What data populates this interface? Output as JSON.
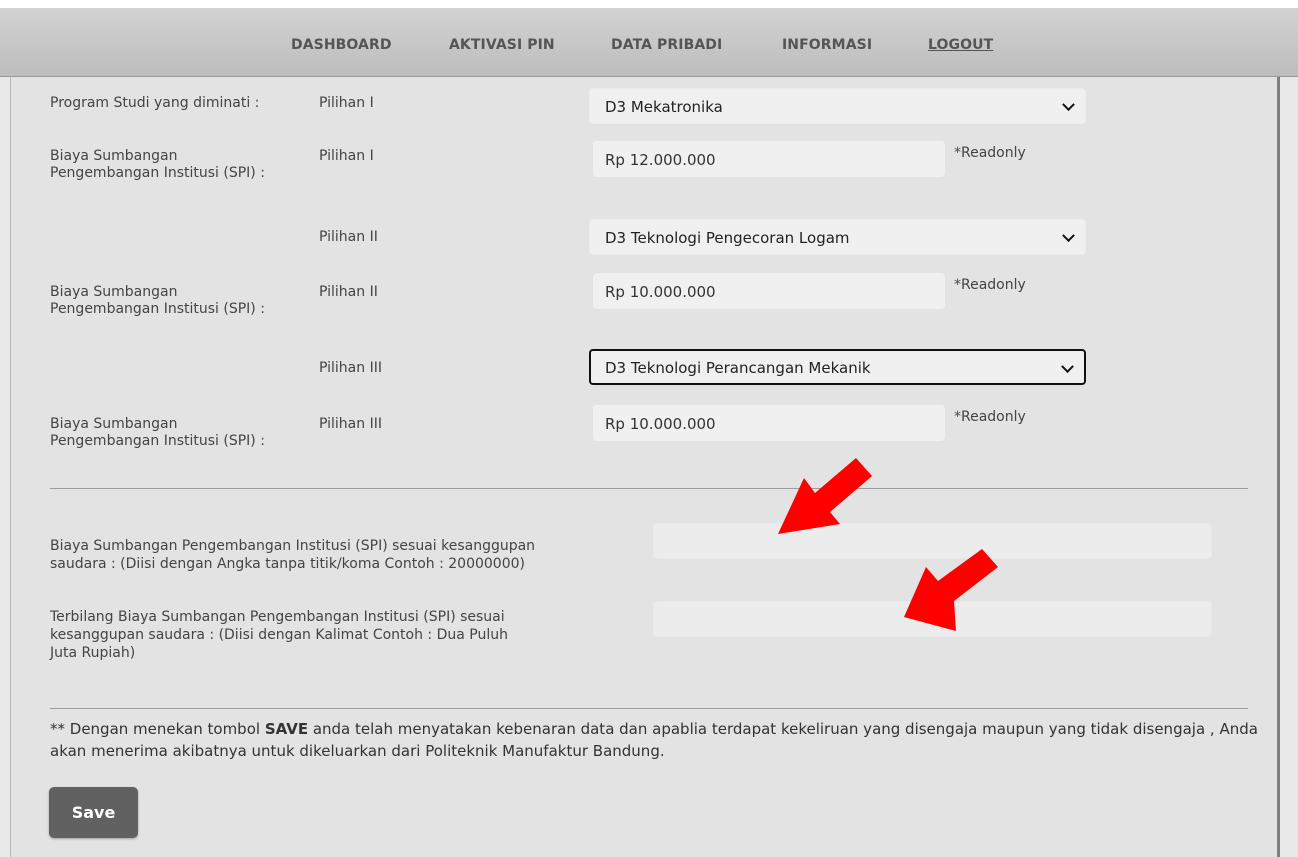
{
  "nav": {
    "dashboard": "DASHBOARD",
    "aktivasi_pin": "AKTIVASI PIN",
    "data_pribadi": "DATA PRIBADI",
    "informasi": "INFORMASI",
    "logout": "LOGOUT"
  },
  "form": {
    "prodi_label": "Program Studi yang diminati :",
    "spi_label_line1": "Biaya Sumbangan",
    "spi_label_line2": "Pengembangan Institusi (SPI) :",
    "pilihan1": "Pilihan I",
    "pilihan2": "Pilihan II",
    "pilihan3": "Pilihan III",
    "select1_value": "D3 Mekatronika",
    "select2_value": "D3 Teknologi Pengecoran Logam",
    "select3_value": "D3 Teknologi Perancangan Mekanik",
    "spi1_value": "Rp 12.000.000",
    "spi2_value": "Rp 10.000.000",
    "spi3_value": "Rp 10.000.000",
    "readonly_note": "*Readonly",
    "kesanggupan_label_line1": "Biaya Sumbangan Pengembangan Institusi (SPI) sesuai kesanggupan",
    "kesanggupan_label_line2": "saudara : (Diisi dengan Angka tanpa titik/koma Contoh : 20000000)",
    "terbilang_label_line1": "Terbilang Biaya Sumbangan Pengembangan Institusi (SPI) sesuai",
    "terbilang_label_line2": "kesanggupan saudara : (Diisi dengan Kalimat Contoh : Dua Puluh",
    "terbilang_label_line3": "Juta Rupiah)",
    "kesanggupan_value": "",
    "terbilang_value": ""
  },
  "disclaimer": {
    "prefix": "** Dengan menekan tombol ",
    "bold": "SAVE",
    "suffix": " anda telah menyatakan kebenaran data dan apablia terdapat kekeliruan yang disengaja maupun yang tidak disengaja , Anda akan menerima akibatnya untuk dikeluarkan dari Politeknik Manufaktur Bandung."
  },
  "save_label": "Save",
  "colors": {
    "arrow": "#ff0000",
    "button": "#616161",
    "navbar": "#c8c8c8"
  }
}
